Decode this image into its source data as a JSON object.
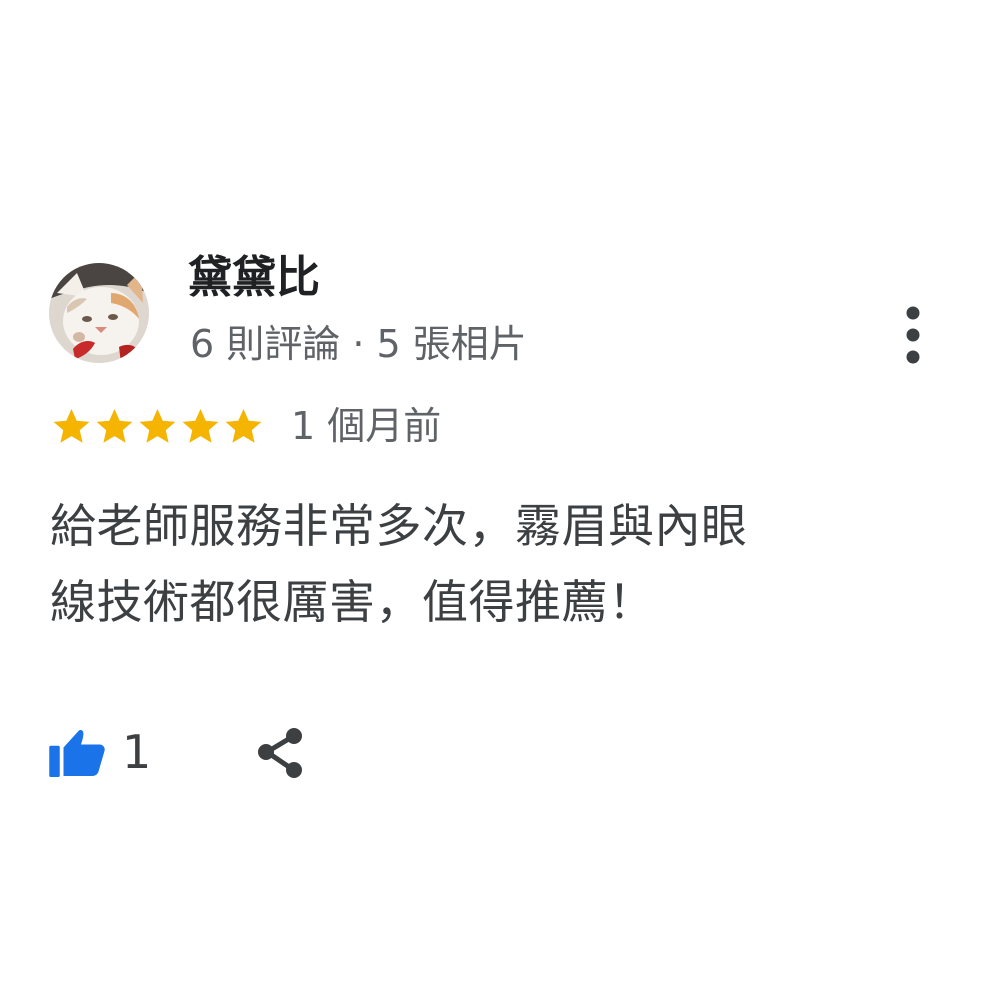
{
  "reviewer": {
    "name": "黛黛比",
    "stats": "6 則評論 · 5 張相片"
  },
  "rating": {
    "stars": 5,
    "max_stars": 5,
    "time_ago": "1 個月前"
  },
  "review": {
    "lines": [
      "給老師服務非常多次，霧眉與內眼",
      "線技術都很厲害，值得推薦！"
    ]
  },
  "actions": {
    "like_count": "1"
  },
  "icons": {
    "avatar": "cat-avatar",
    "star": "star-icon",
    "more": "more-vert-icon",
    "like": "thumbs-up-icon",
    "share": "share-icon"
  },
  "colors": {
    "star": "#f4b400",
    "like": "#1a73e8",
    "text_primary": "#202124",
    "text_secondary": "#5f6368",
    "icon": "#3c4043"
  }
}
